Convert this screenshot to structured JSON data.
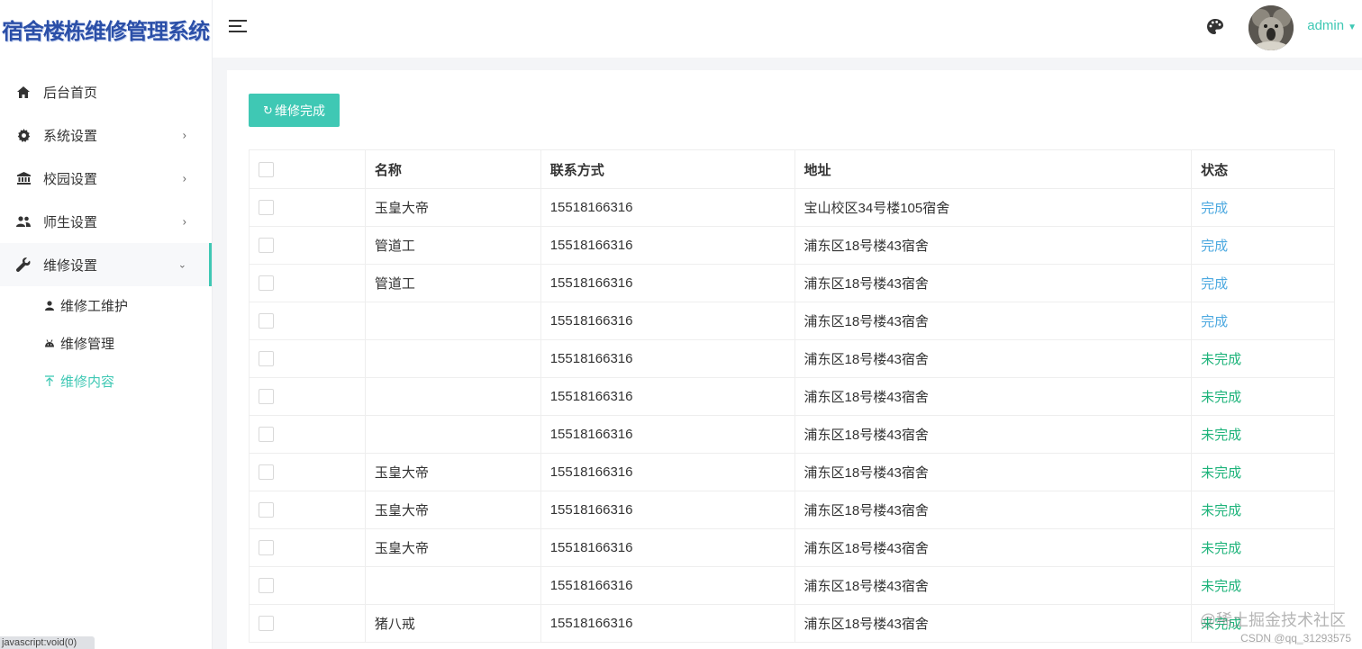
{
  "app": {
    "title": "宿舍楼栋维修管理系统"
  },
  "header": {
    "user_name": "admin"
  },
  "sidebar": {
    "items": [
      {
        "label": "后台首页",
        "icon": "home-icon"
      },
      {
        "label": "系统设置",
        "icon": "gear-icon"
      },
      {
        "label": "校园设置",
        "icon": "bank-icon"
      },
      {
        "label": "师生设置",
        "icon": "people-icon"
      },
      {
        "label": "维修设置",
        "icon": "wrench-icon"
      }
    ],
    "submenu": [
      {
        "label": "维修工维护",
        "icon": "user-icon"
      },
      {
        "label": "维修管理",
        "icon": "android-icon"
      },
      {
        "label": "维修内容",
        "icon": "upload-arrow-icon"
      }
    ]
  },
  "toolbar": {
    "done_label": "维修完成",
    "done_icon": "↻"
  },
  "table": {
    "columns": [
      "名称",
      "联系方式",
      "地址",
      "状态"
    ],
    "rows": [
      {
        "name": "玉皇大帝",
        "phone": "15518166316",
        "address": "宝山校区34号楼105宿舍",
        "status": "完成"
      },
      {
        "name": "管道工",
        "phone": "15518166316",
        "address": "浦东区18号楼43宿舍",
        "status": "完成"
      },
      {
        "name": "管道工",
        "phone": "15518166316",
        "address": "浦东区18号楼43宿舍",
        "status": "完成"
      },
      {
        "name": "",
        "phone": "15518166316",
        "address": "浦东区18号楼43宿舍",
        "status": "完成"
      },
      {
        "name": "",
        "phone": "15518166316",
        "address": "浦东区18号楼43宿舍",
        "status": "未完成"
      },
      {
        "name": "",
        "phone": "15518166316",
        "address": "浦东区18号楼43宿舍",
        "status": "未完成"
      },
      {
        "name": "",
        "phone": "15518166316",
        "address": "浦东区18号楼43宿舍",
        "status": "未完成"
      },
      {
        "name": "玉皇大帝",
        "phone": "15518166316",
        "address": "浦东区18号楼43宿舍",
        "status": "未完成"
      },
      {
        "name": "玉皇大帝",
        "phone": "15518166316",
        "address": "浦东区18号楼43宿舍",
        "status": "未完成"
      },
      {
        "name": "玉皇大帝",
        "phone": "15518166316",
        "address": "浦东区18号楼43宿舍",
        "status": "未完成"
      },
      {
        "name": "",
        "phone": "15518166316",
        "address": "浦东区18号楼43宿舍",
        "status": "未完成"
      },
      {
        "name": "猪八戒",
        "phone": "15518166316",
        "address": "浦东区18号楼43宿舍",
        "status": "未完成"
      }
    ]
  },
  "colors": {
    "accent": "#3fc8b4",
    "done": "#4da9e0",
    "undone": "#1db37a"
  },
  "statusbar": {
    "url": "javascript:void(0)"
  },
  "watermark": {
    "line1": "@稀土掘金技术社区",
    "line2": "CSDN @qq_31293575"
  }
}
